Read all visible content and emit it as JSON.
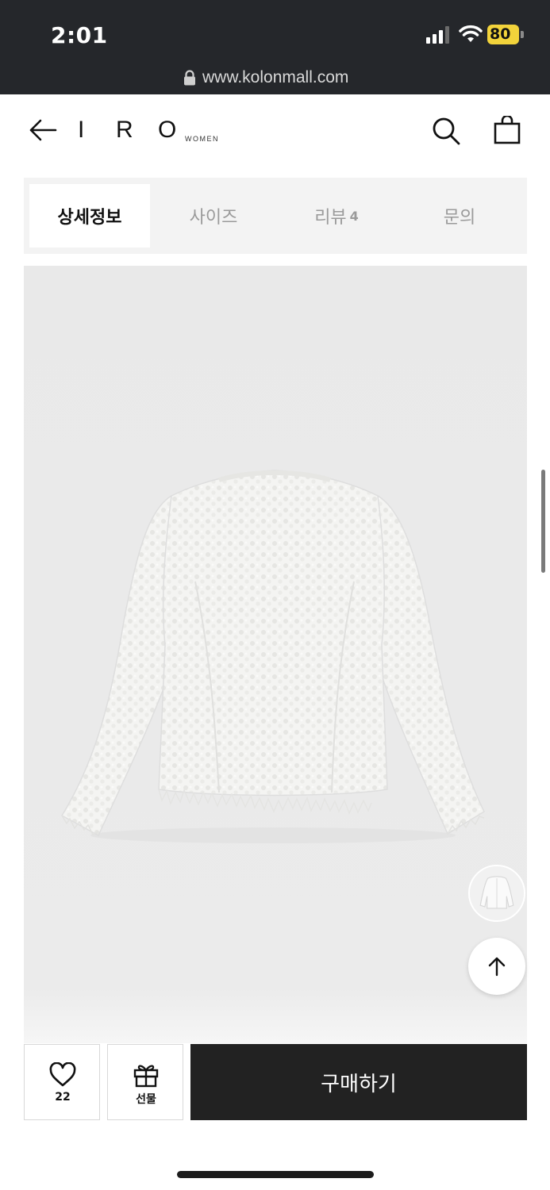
{
  "status_bar": {
    "time": "2:01",
    "battery": "80",
    "url": "www.kolonmall.com"
  },
  "header": {
    "logo_letters": [
      "I",
      "R",
      "O"
    ],
    "logo_sub": "WOMEN"
  },
  "tabs": [
    {
      "label": "상세정보",
      "active": true
    },
    {
      "label": "사이즈",
      "active": false
    },
    {
      "label": "리뷰",
      "count": "4",
      "active": false
    },
    {
      "label": "문의",
      "active": false
    }
  ],
  "actions": {
    "like_count": "22",
    "gift_label": "선물",
    "buy_label": "구매하기"
  },
  "colors": {
    "status_bg": "#25272b",
    "buy_bg": "#222222",
    "battery": "#f2d33b",
    "image_bg": "#e9e9e9"
  }
}
